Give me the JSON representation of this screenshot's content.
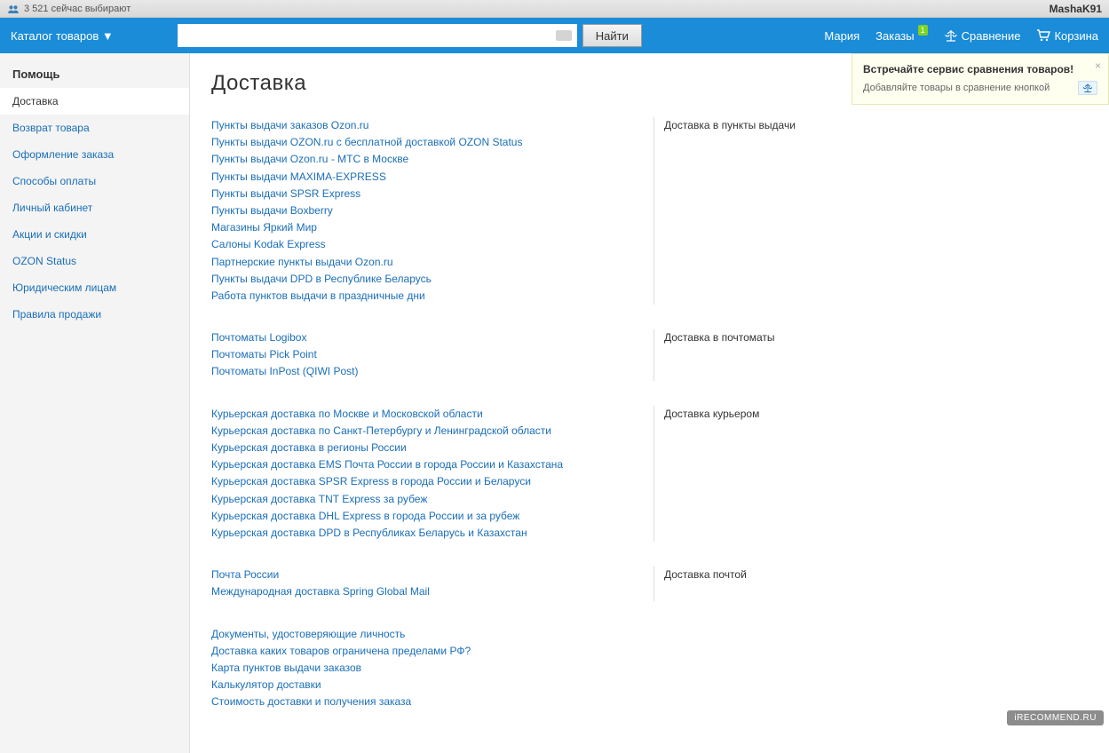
{
  "top_strip": {
    "visitors_text": "3 521 сейчас выбирают",
    "username": "MashaK91"
  },
  "header": {
    "catalog_label": "Каталог товаров ▼",
    "search_button": "Найти",
    "user_name": "Мария",
    "orders_label": "Заказы",
    "orders_badge": "1",
    "compare_label": "Сравнение",
    "cart_label": "Корзина"
  },
  "sidebar": {
    "title": "Помощь",
    "items": [
      "Доставка",
      "Возврат товара",
      "Оформление заказа",
      "Способы оплаты",
      "Личный кабинет",
      "Акции и скидки",
      "OZON Status",
      "Юридическим лицам",
      "Правила продажи"
    ]
  },
  "page": {
    "title": "Доставка"
  },
  "sections": [
    {
      "heading": "Доставка в пункты выдачи",
      "links": [
        "Пункты выдачи заказов Ozon.ru",
        "Пункты выдачи OZON.ru с бесплатной доставкой OZON Status",
        "Пункты выдачи Ozon.ru - МТС в Москве",
        "Пункты выдачи MAXIMA-EXPRESS",
        "Пункты выдачи SPSR Express",
        "Пункты выдачи Boxberry",
        "Магазины Яркий Мир",
        "Салоны Kodak Express",
        "Партнерские пункты выдачи Ozon.ru",
        "Пункты выдачи DPD в Республике Беларусь",
        "Работа пунктов выдачи в праздничные дни"
      ]
    },
    {
      "heading": "Доставка в почтоматы",
      "links": [
        "Почтоматы Logibox",
        "Почтоматы Pick Point",
        "Почтоматы InPost (QIWI Post)"
      ]
    },
    {
      "heading": "Доставка курьером",
      "links": [
        "Курьерская доставка по Москве и Московской области",
        "Курьерская доставка по Санкт-Петербургу и Ленинградской области",
        "Курьерская доставка в регионы России",
        "Курьерская доставка EMS Почта России в города России и Казахстана",
        "Курьерская доставка SPSR Express в города России и Беларуси",
        "Курьерская доставка TNT Express за рубеж",
        "Курьерская доставка DHL Express в города России и за рубеж",
        "Курьерская доставка DPD в Республиках Беларусь и Казахстан"
      ]
    },
    {
      "heading": "Доставка почтой",
      "links": [
        "Почта России",
        "Международная доставка Spring Global Mail"
      ]
    },
    {
      "heading": "",
      "links": [
        "Документы, удостоверяющие личность",
        "Доставка каких товаров ограничена пределами РФ?",
        "Карта пунктов выдачи заказов",
        "Калькулятор доставки",
        "Стоимость доставки и получения заказа"
      ]
    }
  ],
  "notify": {
    "title": "Встречайте сервис сравнения товаров!",
    "body": "Добавляйте товары в сравнение кнопкой"
  },
  "watermark": "iRECOMMEND.RU"
}
